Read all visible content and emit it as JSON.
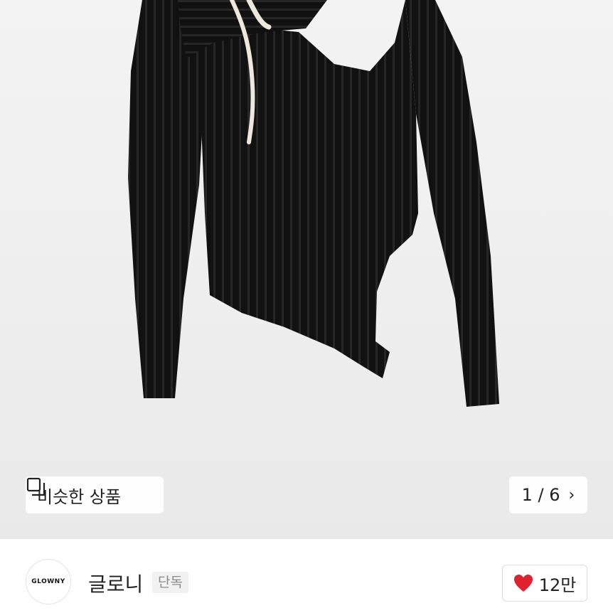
{
  "image": {
    "alt": "Black ribbed asymmetric top",
    "counter": "1 / 6"
  },
  "similar": {
    "label": "비슷한 상품",
    "icon": "copy-icon"
  },
  "pager": {
    "chevron": "›",
    "icon": "chevron-right-icon"
  },
  "seller": {
    "logo_text": "GLOWNY",
    "name": "글로니",
    "badge": "단독"
  },
  "likes": {
    "count": "12만",
    "icon": "heart-icon",
    "color": "#e0222e"
  }
}
